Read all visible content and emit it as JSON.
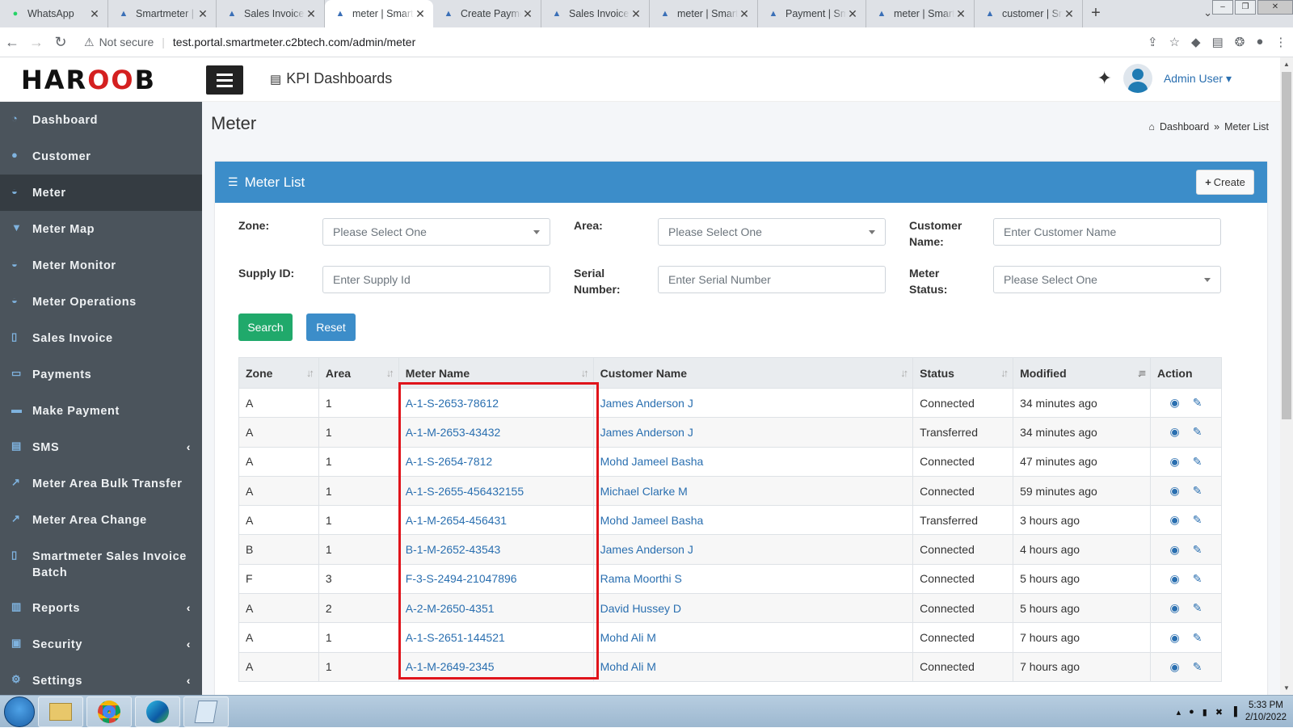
{
  "browser": {
    "tabs": [
      {
        "title": "WhatsApp",
        "icon": "whatsapp-icon"
      },
      {
        "title": "Smartmeter | ",
        "icon": "drop-icon"
      },
      {
        "title": "Sales Invoice",
        "icon": "drop-icon"
      },
      {
        "title": "meter | Smart",
        "icon": "drop-icon"
      },
      {
        "title": "Create Payme",
        "icon": "drop-icon"
      },
      {
        "title": "Sales Invoice",
        "icon": "drop-icon"
      },
      {
        "title": "meter | Smart",
        "icon": "drop-icon"
      },
      {
        "title": "Payment | Sm",
        "icon": "drop-icon"
      },
      {
        "title": "meter | Smart",
        "icon": "drop-icon"
      },
      {
        "title": "customer | Sm",
        "icon": "drop-icon"
      }
    ],
    "security_label": "Not secure",
    "url": "test.portal.smartmeter.c2btech.com/admin/meter"
  },
  "header": {
    "logo_left": "HAR",
    "logo_mid": "OO",
    "logo_right": "B",
    "kpi_label": "KPI Dashboards",
    "user_name": "Admin User"
  },
  "sidebar": {
    "items": [
      {
        "label": "Dashboard",
        "icon": "pie-chart-icon"
      },
      {
        "label": "Customer",
        "icon": "user-icon"
      },
      {
        "label": "Meter",
        "icon": "gauge-icon"
      },
      {
        "label": "Meter Map",
        "icon": "map-marker-icon"
      },
      {
        "label": "Meter Monitor",
        "icon": "gauge-icon"
      },
      {
        "label": "Meter Operations",
        "icon": "gauge-icon"
      },
      {
        "label": "Sales Invoice",
        "icon": "file-icon"
      },
      {
        "label": "Payments",
        "icon": "money-icon"
      },
      {
        "label": "Make Payment",
        "icon": "credit-card-icon"
      },
      {
        "label": "SMS",
        "icon": "sms-icon"
      },
      {
        "label": "Meter Area Bulk Transfer",
        "icon": "transfer-icon"
      },
      {
        "label": "Meter Area Change",
        "icon": "transfer-icon"
      },
      {
        "label": "Smartmeter Sales Invoice Batch",
        "icon": "file-icon"
      },
      {
        "label": "Reports",
        "icon": "book-icon"
      },
      {
        "label": "Security",
        "icon": "lock-icon"
      },
      {
        "label": "Settings",
        "icon": "gear-icon"
      }
    ]
  },
  "page": {
    "title": "Meter",
    "breadcrumb_home": "Dashboard",
    "breadcrumb_sep": "»",
    "breadcrumb_current": "Meter List"
  },
  "card": {
    "title": "Meter List",
    "create_label": "Create"
  },
  "filters": {
    "zone_label": "Zone:",
    "zone_value": "Please Select One",
    "area_label": "Area:",
    "area_value": "Please Select One",
    "customer_label": "Customer Name:",
    "customer_placeholder": "Enter Customer Name",
    "supply_label": "Supply ID:",
    "supply_placeholder": "Enter Supply Id",
    "serial_label": "Serial Number:",
    "serial_placeholder": "Enter Serial Number",
    "status_label": "Meter Status:",
    "status_value": "Please Select One",
    "search_label": "Search",
    "reset_label": "Reset"
  },
  "table": {
    "columns": [
      "Zone",
      "Area",
      "Meter Name",
      "Customer Name",
      "Status",
      "Modified",
      "Action"
    ],
    "rows": [
      {
        "zone": "A",
        "area": "1",
        "meter": "A-1-S-2653-78612",
        "customer": "James Anderson J",
        "status": "Connected",
        "modified": "34 minutes ago"
      },
      {
        "zone": "A",
        "area": "1",
        "meter": "A-1-M-2653-43432",
        "customer": "James Anderson J",
        "status": "Transferred",
        "modified": "34 minutes ago"
      },
      {
        "zone": "A",
        "area": "1",
        "meter": "A-1-S-2654-7812",
        "customer": "Mohd Jameel Basha",
        "status": "Connected",
        "modified": "47 minutes ago"
      },
      {
        "zone": "A",
        "area": "1",
        "meter": "A-1-S-2655-456432155",
        "customer": "Michael Clarke M",
        "status": "Connected",
        "modified": "59 minutes ago"
      },
      {
        "zone": "A",
        "area": "1",
        "meter": "A-1-M-2654-456431",
        "customer": "Mohd Jameel Basha",
        "status": "Transferred",
        "modified": "3 hours ago"
      },
      {
        "zone": "B",
        "area": "1",
        "meter": "B-1-M-2652-43543",
        "customer": "James Anderson J",
        "status": "Connected",
        "modified": "4 hours ago"
      },
      {
        "zone": "F",
        "area": "3",
        "meter": "F-3-S-2494-21047896",
        "customer": "Rama Moorthi S",
        "status": "Connected",
        "modified": "5 hours ago"
      },
      {
        "zone": "A",
        "area": "2",
        "meter": "A-2-M-2650-4351",
        "customer": "David Hussey D",
        "status": "Connected",
        "modified": "5 hours ago"
      },
      {
        "zone": "A",
        "area": "1",
        "meter": "A-1-S-2651-144521",
        "customer": "Mohd Ali M",
        "status": "Connected",
        "modified": "7 hours ago"
      },
      {
        "zone": "A",
        "area": "1",
        "meter": "A-1-M-2649-2345",
        "customer": "Mohd Ali M",
        "status": "Connected",
        "modified": "7 hours ago"
      }
    ]
  },
  "taskbar": {
    "time": "5:33 PM",
    "date": "2/10/2022"
  },
  "colors": {
    "primary": "#3c8dc9",
    "success": "#20a96b",
    "sidebar": "#4b545c",
    "highlight": "#e0141b"
  }
}
